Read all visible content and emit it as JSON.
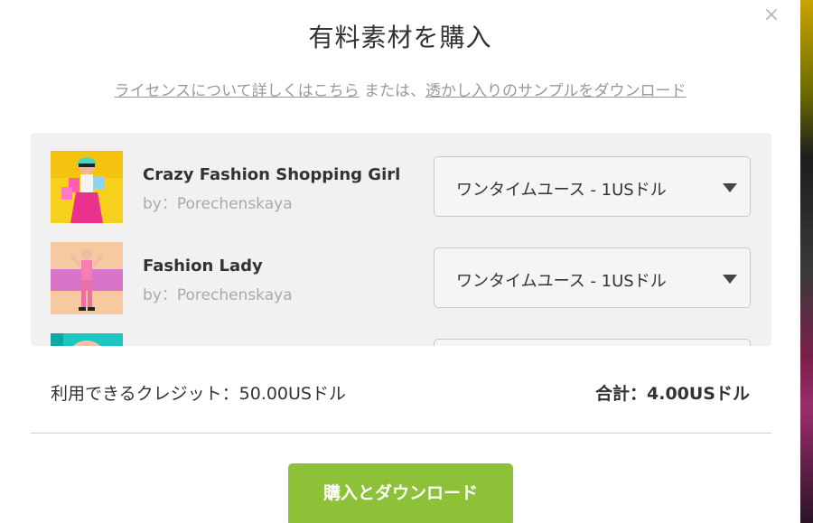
{
  "modal": {
    "title": "有料素材を購入",
    "close_glyph": "×",
    "links": {
      "license_link": "ライセンスについて詳しくはこちら",
      "separator": " または、",
      "sample_link": "透かし入りのサンプルをダウンロード"
    }
  },
  "items": [
    {
      "name": "Crazy Fashion Shopping Girl",
      "author": "by：Porechenskaya",
      "license": "ワンタイムユース - 1USドル",
      "thumb_icon": "fashion-shopping-girl-thumbnail"
    },
    {
      "name": "Fashion Lady",
      "author": "by：Porechenskaya",
      "license": "ワンタイムユース - 1USドル",
      "thumb_icon": "fashion-lady-thumbnail"
    },
    {
      "name": "",
      "author": "",
      "license": "",
      "thumb_icon": "partially-visible-thumbnail"
    }
  ],
  "summary": {
    "credits": "利用できるクレジット：50.00USドル",
    "total": "合計：4.00USドル"
  },
  "buy_button": "購入とダウンロード",
  "colors": {
    "accent_green": "#8dc137",
    "panel_bg": "#f1f1f1",
    "link_gray": "#999999"
  }
}
